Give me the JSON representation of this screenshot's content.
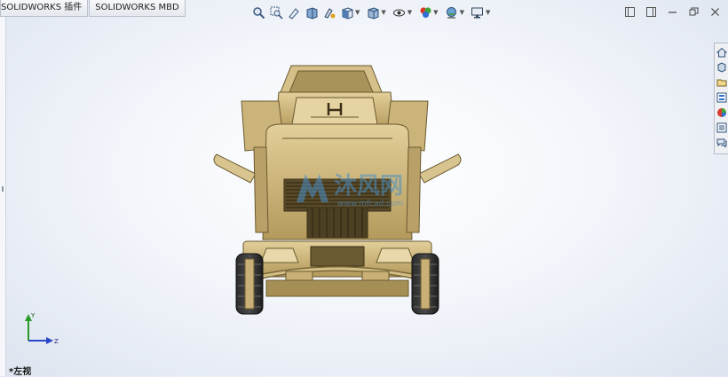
{
  "tabs": [
    {
      "label": "SOLIDWORKS 插件"
    },
    {
      "label": "SOLIDWORKS MBD"
    }
  ],
  "view": {
    "orientation_label": "*左视"
  },
  "triad": {
    "y_label": "Y",
    "z_label": "Z"
  },
  "watermark": {
    "logo_text": "沐风网",
    "url": "www.mfcad.com"
  },
  "heads_up_toolbar": {
    "icons": [
      "zoom-to-fit-icon",
      "zoom-to-area-icon",
      "previous-view-icon",
      "section-view-icon",
      "dynamic-annotation-icon",
      "view-orientation-icon",
      "display-style-icon",
      "hide-show-items-icon",
      "edit-appearance-icon",
      "apply-scene-icon",
      "view-settings-icon"
    ]
  },
  "task_pane": {
    "icons": [
      "home-icon",
      "design-library-icon",
      "file-explorer-icon",
      "view-palette-icon",
      "appearances-icon",
      "custom-properties-icon",
      "forum-icon"
    ]
  },
  "colors": {
    "model_body": "#c8b077",
    "model_shadow": "#8f7a48",
    "triad_y": "#2a9a2a",
    "triad_z": "#2846c8",
    "watermark": "#4a90c8"
  }
}
